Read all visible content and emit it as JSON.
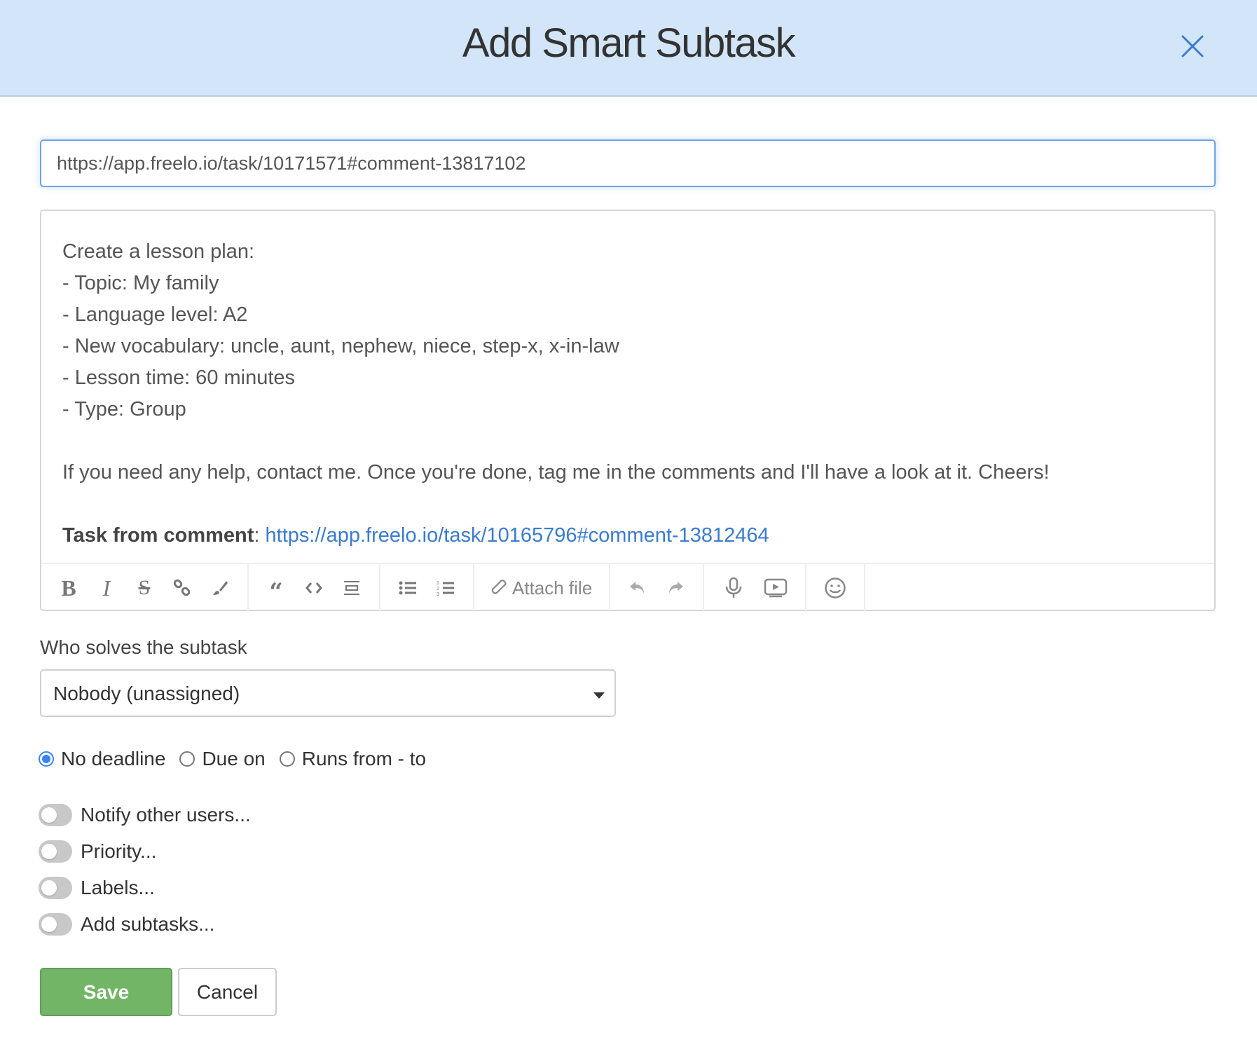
{
  "dialog": {
    "title": "Add Smart Subtask",
    "close_icon": "close-icon"
  },
  "url_input": {
    "value": "https://app.freelo.io/task/10171571#comment-13817102"
  },
  "editor": {
    "lines": [
      "Create a lesson plan:",
      "- Topic: My family",
      "- Language level: A2",
      "- New vocabulary: uncle, aunt, nephew, niece, step-x, x-in-law",
      "- Lesson time: 60 minutes",
      "- Type: Group",
      "",
      "If you need any help, contact me. Once you're done, tag me in the comments and I'll have a look at it. Cheers!",
      ""
    ],
    "source_label": "Task from comment",
    "source_sep": ": ",
    "source_link": "https://app.freelo.io/task/10165796#comment-13812464",
    "toolbar": {
      "bold": "bold-icon",
      "italic": "italic-icon",
      "strike": "strikethrough-icon",
      "link": "link-icon",
      "brush": "brush-icon",
      "quote": "quote-icon",
      "code": "code-icon",
      "hr": "horizontal-rule-icon",
      "ul": "bullet-list-icon",
      "ol": "numbered-list-icon",
      "attach_label": "Attach file",
      "undo": "undo-icon",
      "redo": "redo-icon",
      "mic": "microphone-icon",
      "video": "video-icon",
      "emoji": "emoji-icon"
    }
  },
  "assignee": {
    "label": "Who solves the subtask",
    "selected": "Nobody (unassigned)"
  },
  "deadline": {
    "options": [
      {
        "label": "No deadline",
        "checked": true
      },
      {
        "label": "Due on",
        "checked": false
      },
      {
        "label": "Runs from - to",
        "checked": false
      }
    ]
  },
  "toggles": [
    {
      "label": "Notify other users...",
      "on": false
    },
    {
      "label": "Priority...",
      "on": false
    },
    {
      "label": "Labels...",
      "on": false
    },
    {
      "label": "Add subtasks...",
      "on": false
    }
  ],
  "actions": {
    "save": "Save",
    "cancel": "Cancel"
  },
  "colors": {
    "header_bg": "#d3e5f8",
    "accent": "#3a7bcf",
    "save_green": "#73b566"
  }
}
